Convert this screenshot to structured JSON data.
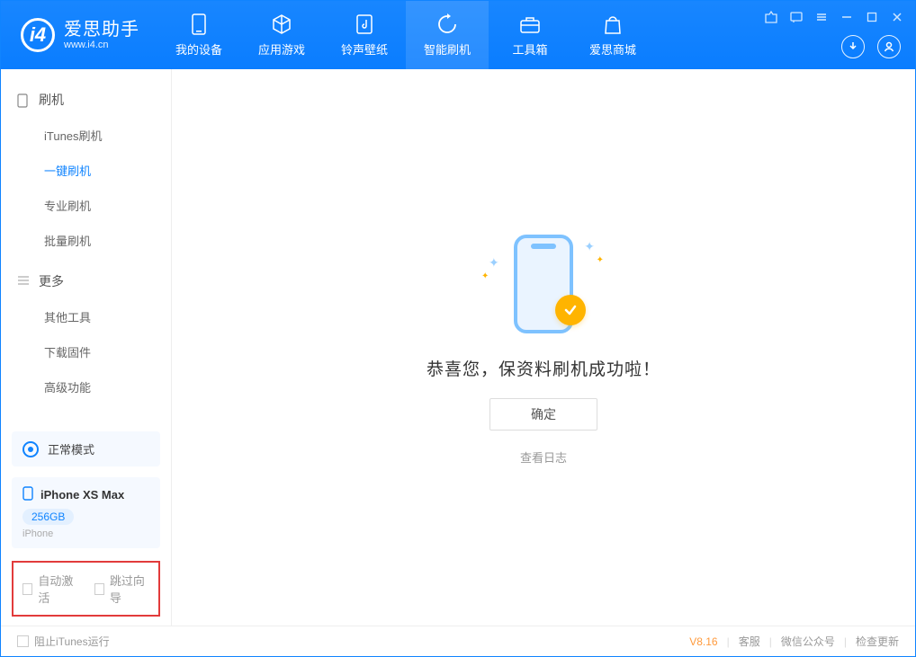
{
  "app": {
    "title": "爱思助手",
    "subtitle": "www.i4.cn"
  },
  "tabs": {
    "device": "我的设备",
    "apps": "应用游戏",
    "ringtone": "铃声壁纸",
    "flash": "智能刷机",
    "toolbox": "工具箱",
    "store": "爱思商城"
  },
  "sidebar": {
    "section1": "刷机",
    "items1": [
      "iTunes刷机",
      "一键刷机",
      "专业刷机",
      "批量刷机"
    ],
    "section2": "更多",
    "items2": [
      "其他工具",
      "下载固件",
      "高级功能"
    ]
  },
  "mode": {
    "label": "正常模式"
  },
  "device": {
    "name": "iPhone XS Max",
    "storage": "256GB",
    "type": "iPhone"
  },
  "options": {
    "auto_activate": "自动激活",
    "skip_guide": "跳过向导"
  },
  "main": {
    "success": "恭喜您，保资料刷机成功啦！",
    "ok": "确定",
    "view_log": "查看日志"
  },
  "status": {
    "block_itunes": "阻止iTunes运行",
    "version": "V8.16",
    "support": "客服",
    "wechat": "微信公众号",
    "update": "检查更新"
  }
}
